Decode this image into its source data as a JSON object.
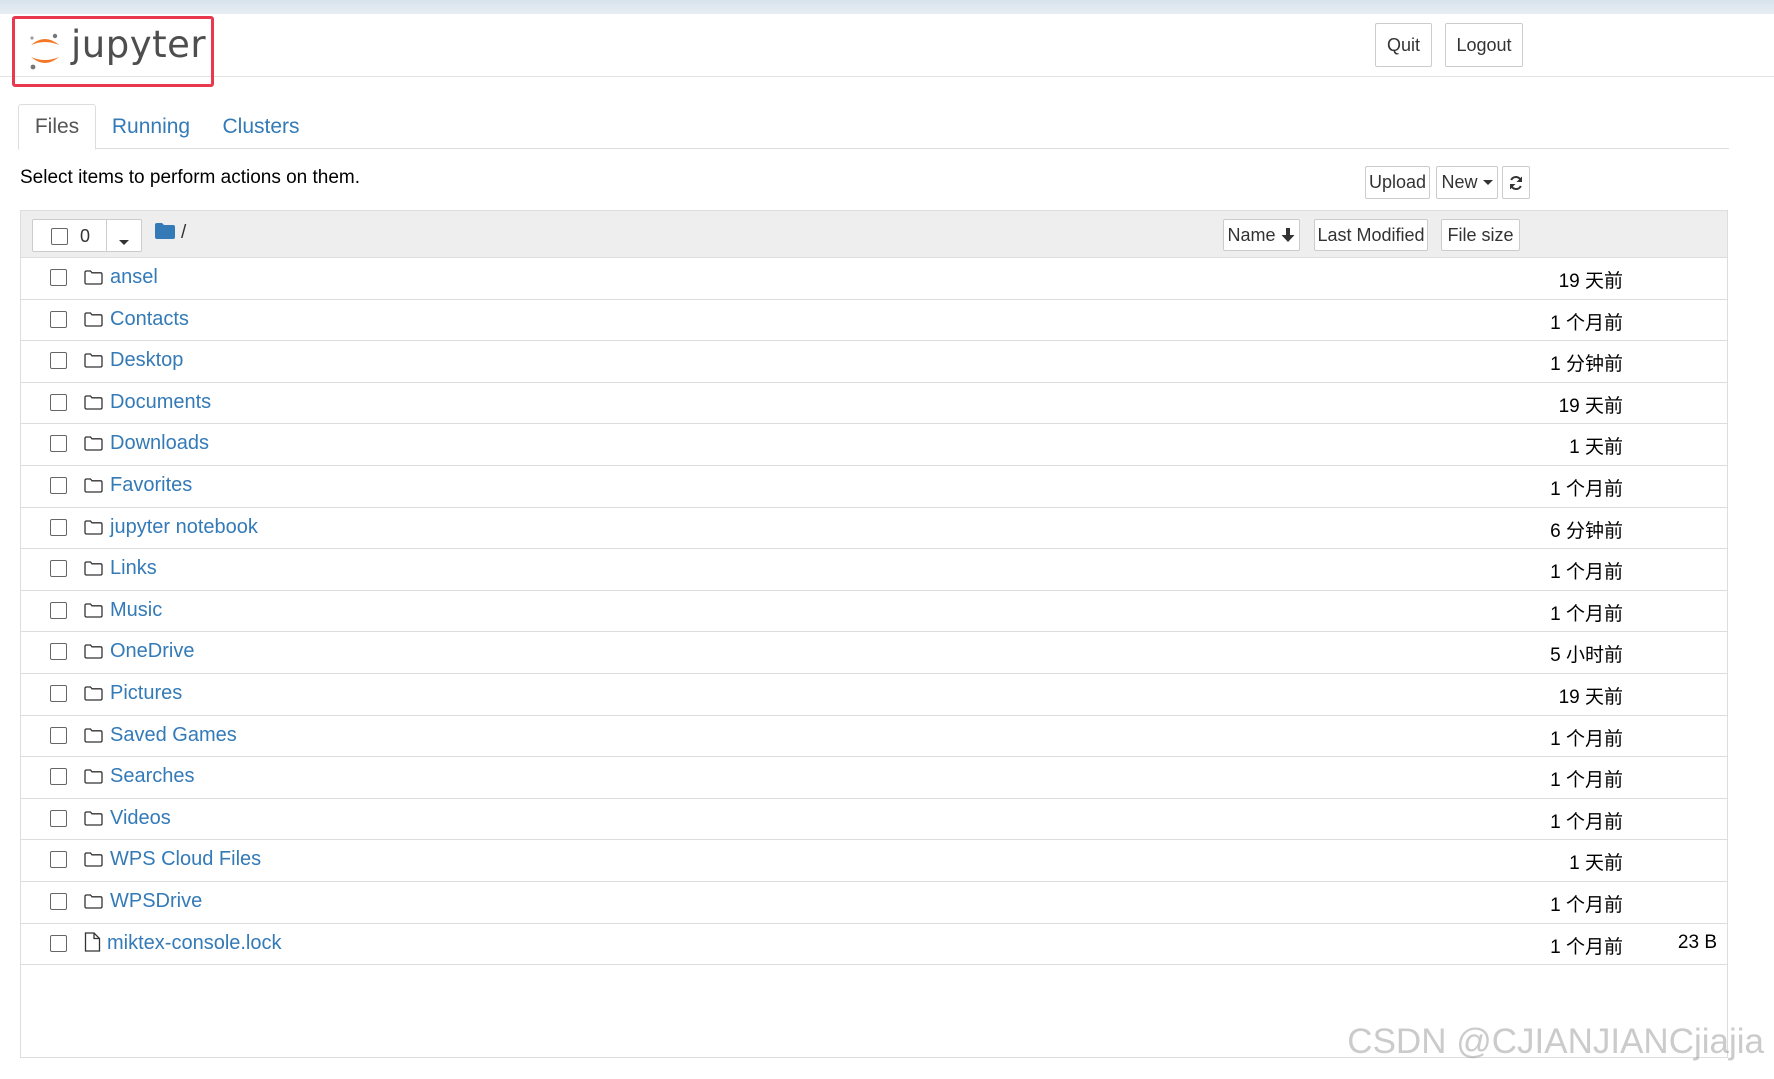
{
  "header": {
    "logo_text": "jupyter",
    "quit_label": "Quit",
    "logout_label": "Logout"
  },
  "tabs": [
    {
      "label": "Files",
      "active": true
    },
    {
      "label": "Running",
      "active": false
    },
    {
      "label": "Clusters",
      "active": false
    }
  ],
  "toolbar": {
    "instructions": "Select items to perform actions on them.",
    "upload_label": "Upload",
    "new_label": "New",
    "refresh_icon": "refresh-icon"
  },
  "list_header": {
    "selected_count": "0",
    "path": "/",
    "sort_name_label": "Name",
    "sort_modified_label": "Last Modified",
    "sort_size_label": "File size"
  },
  "items": [
    {
      "name": "ansel",
      "type": "folder",
      "modified": "19 天前",
      "size": ""
    },
    {
      "name": "Contacts",
      "type": "folder",
      "modified": "1 个月前",
      "size": ""
    },
    {
      "name": "Desktop",
      "type": "folder",
      "modified": "1 分钟前",
      "size": ""
    },
    {
      "name": "Documents",
      "type": "folder",
      "modified": "19 天前",
      "size": ""
    },
    {
      "name": "Downloads",
      "type": "folder",
      "modified": "1 天前",
      "size": ""
    },
    {
      "name": "Favorites",
      "type": "folder",
      "modified": "1 个月前",
      "size": ""
    },
    {
      "name": "jupyter notebook",
      "type": "folder",
      "modified": "6 分钟前",
      "size": ""
    },
    {
      "name": "Links",
      "type": "folder",
      "modified": "1 个月前",
      "size": ""
    },
    {
      "name": "Music",
      "type": "folder",
      "modified": "1 个月前",
      "size": ""
    },
    {
      "name": "OneDrive",
      "type": "folder",
      "modified": "5 小时前",
      "size": ""
    },
    {
      "name": "Pictures",
      "type": "folder",
      "modified": "19 天前",
      "size": ""
    },
    {
      "name": "Saved Games",
      "type": "folder",
      "modified": "1 个月前",
      "size": ""
    },
    {
      "name": "Searches",
      "type": "folder",
      "modified": "1 个月前",
      "size": ""
    },
    {
      "name": "Videos",
      "type": "folder",
      "modified": "1 个月前",
      "size": ""
    },
    {
      "name": "WPS Cloud Files",
      "type": "folder",
      "modified": "1 天前",
      "size": ""
    },
    {
      "name": "WPSDrive",
      "type": "folder",
      "modified": "1 个月前",
      "size": ""
    },
    {
      "name": "miktex-console.lock",
      "type": "file",
      "modified": "1 个月前",
      "size": "23 B"
    }
  ],
  "watermark": "CSDN @CJIANJIANCjiajia",
  "colors": {
    "link": "#337ab7",
    "highlight_box": "#e8394f",
    "logo_orange": "#f37726"
  }
}
